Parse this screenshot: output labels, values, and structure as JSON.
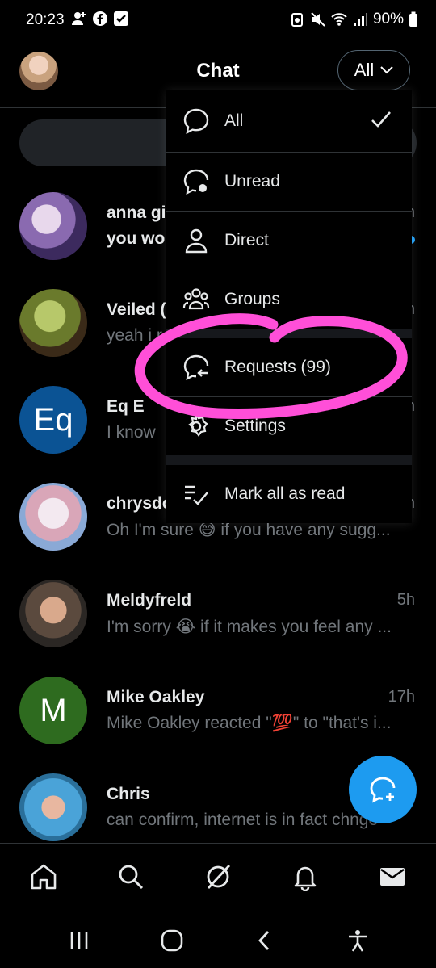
{
  "status_bar": {
    "time": "20:23",
    "battery": "90%"
  },
  "header": {
    "title": "Chat",
    "filter_label": "All"
  },
  "menu": {
    "items": [
      {
        "label": "All",
        "icon": "chat-bubble-icon",
        "checked": true
      },
      {
        "label": "Unread",
        "icon": "chat-bubble-dot-icon"
      },
      {
        "label": "Direct",
        "icon": "person-icon"
      },
      {
        "label": "Groups",
        "icon": "group-icon"
      },
      {
        "label": "Requests (99)",
        "icon": "chat-bubble-arrow-icon"
      },
      {
        "label": "Settings",
        "icon": "gear-icon"
      },
      {
        "label": "Mark all as read",
        "icon": "double-check-icon"
      }
    ]
  },
  "chats": [
    {
      "name": "anna gi",
      "time": "h",
      "preview": "you wo",
      "unread": true,
      "avatar": "anime-avatar"
    },
    {
      "name": "Veiled (",
      "time": "h",
      "preview": "yeah i r",
      "unread": false,
      "avatar": "chameleon-avatar"
    },
    {
      "name": "Eq E",
      "time": "h",
      "preview": "I know",
      "unread": false,
      "avatar_text": "Eq",
      "avatar_color": "#0b5394"
    },
    {
      "name": "chrysdc",
      "time": "h",
      "preview": "Oh I'm sure 😅 if you have any sugg...",
      "unread": false,
      "avatar": "art-avatar"
    },
    {
      "name": "Meldyfreld",
      "time": "5h",
      "preview": "I'm sorry 😭 if it makes you feel any ...",
      "unread": false,
      "avatar": "photo-avatar"
    },
    {
      "name": "Mike Oakley",
      "time": "17h",
      "preview": "Mike Oakley reacted \"💯\" to \"that's i...",
      "unread": false,
      "avatar_text": "M",
      "avatar_color": "#2e6b1f"
    },
    {
      "name": "Chris",
      "time": "",
      "preview": "can confirm, internet is in fact chnge",
      "unread": false,
      "avatar": "costume-avatar"
    }
  ],
  "colors": {
    "accent": "#1d9bf0",
    "highlight": "#ff4fd8"
  }
}
